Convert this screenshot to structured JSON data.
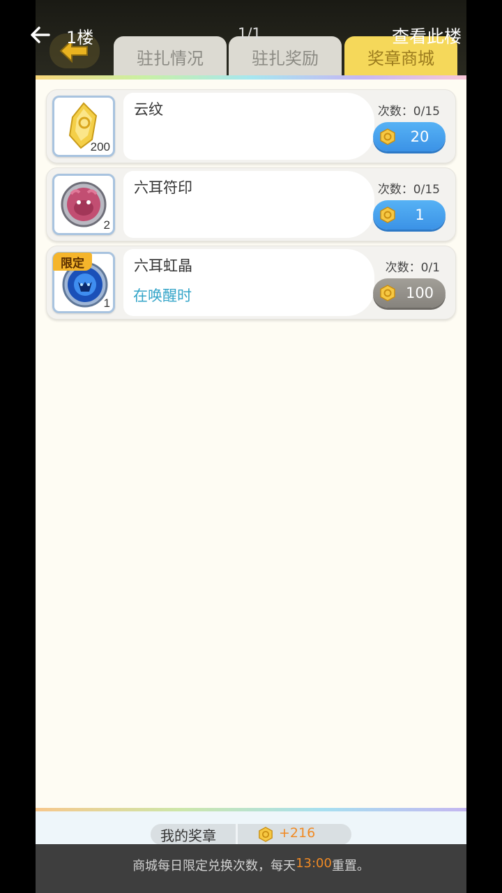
{
  "header": {
    "floor_label": "1楼",
    "page_indicator": "1/1",
    "view_floor_label": "查看此楼"
  },
  "tabs": [
    {
      "label": "驻扎情况",
      "active": false
    },
    {
      "label": "驻扎奖励",
      "active": false
    },
    {
      "label": "奖章商城",
      "active": true
    }
  ],
  "items": [
    {
      "name": "云纹",
      "count": "200",
      "limited": false,
      "subtitle": "",
      "count_label": "次数：0/15",
      "price": "20",
      "enabled": true,
      "icon": "cloud-pattern-icon"
    },
    {
      "name": "六耳符印",
      "count": "2",
      "limited": false,
      "subtitle": "",
      "count_label": "次数：0/15",
      "price": "1",
      "enabled": true,
      "icon": "six-ear-seal-icon"
    },
    {
      "name": "六耳虹晶",
      "count": "1",
      "limited": true,
      "limited_label": "限定",
      "subtitle": "在唤醒时",
      "count_label": "次数：0/1",
      "price": "100",
      "enabled": false,
      "icon": "six-ear-crystal-icon"
    }
  ],
  "bottom": {
    "medal_label": "我的奖章",
    "medal_value": "+216",
    "notice_prefix": "商城每日限定兑换次数，每天",
    "notice_time": "13:00",
    "notice_suffix": "重置。"
  },
  "colors": {
    "accent_tab": "#f5d85a",
    "buy_button": "#3b92e6",
    "disabled_button": "#86837d",
    "highlight": "#f08a24",
    "subtitle": "#33a4c8"
  }
}
